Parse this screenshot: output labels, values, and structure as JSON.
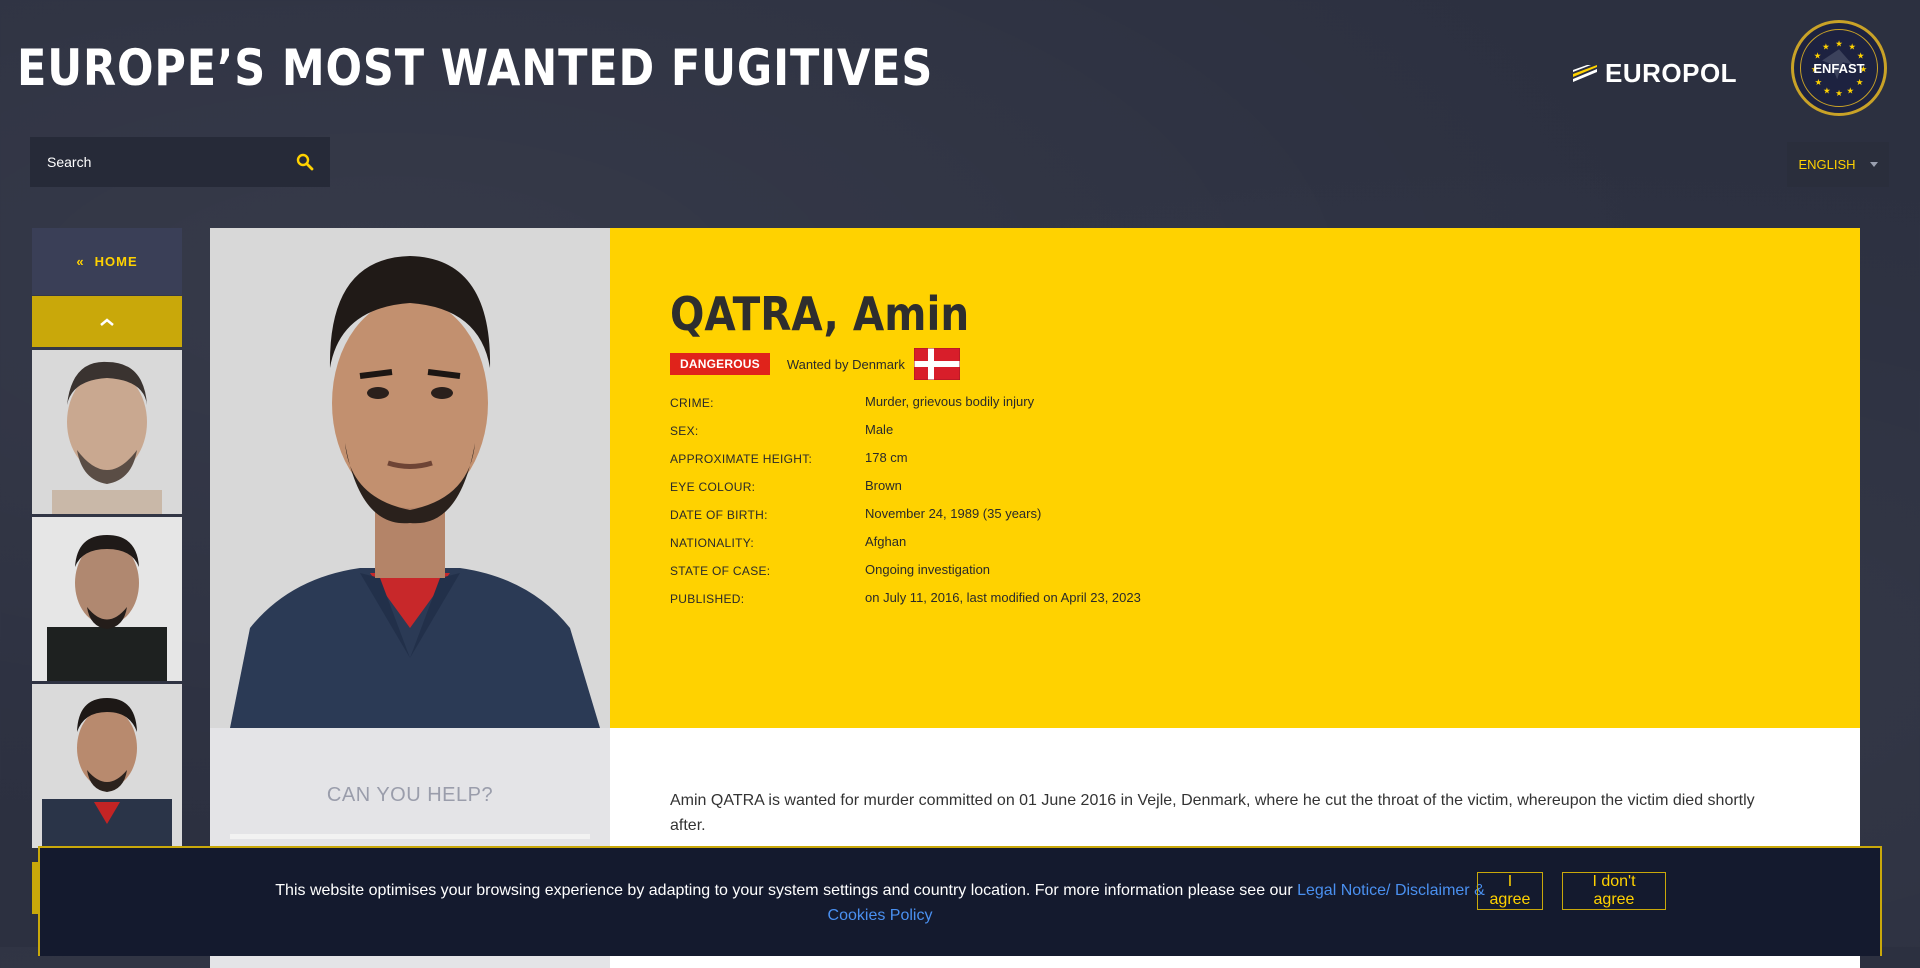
{
  "header": {
    "title": "EUROPE’S MOST WANTED FUGITIVES",
    "europol_label": "EUROPOL",
    "enfast_label": "ENFAST"
  },
  "search": {
    "placeholder": "Search"
  },
  "language": {
    "selected": "ENGLISH"
  },
  "sidebar": {
    "home_label": "HOME"
  },
  "profile": {
    "name": "QATRA, Amin",
    "badge": "DANGEROUS",
    "wanted_by": "Wanted by Denmark",
    "details": [
      {
        "label": "CRIME:",
        "value": "Murder, grievous bodily injury"
      },
      {
        "label": "SEX:",
        "value": "Male"
      },
      {
        "label": "APPROXIMATE HEIGHT:",
        "value": "178 cm"
      },
      {
        "label": "EYE COLOUR:",
        "value": "Brown"
      },
      {
        "label": "DATE OF BIRTH:",
        "value": "November 24, 1989 (35 years)"
      },
      {
        "label": "NATIONALITY:",
        "value": "Afghan"
      },
      {
        "label": "STATE OF CASE:",
        "value": "Ongoing investigation"
      },
      {
        "label": "PUBLISHED:",
        "value": "on July 11, 2016, last modified on April 23, 2023"
      }
    ],
    "help_title": "CAN YOU HELP?",
    "description": "Amin QATRA is wanted for murder committed on 01 June 2016 in Vejle, Denmark, where he cut the throat of the victim, whereupon the victim died shortly after."
  },
  "cookie": {
    "text": "This website optimises your browsing experience by adapting to your system settings and country location. For more information please see our",
    "link_label": "Legal Notice/ Disclaimer & Cookies Policy",
    "agree_label": "I agree",
    "disagree_label": "I don't agree"
  },
  "colors": {
    "accent_yellow": "#ffd200",
    "danger_red": "#e0231b",
    "background": "#2c3040",
    "link_blue": "#4a90f0"
  },
  "icons": [
    "search-icon",
    "double-chevron-left-icon",
    "chevron-up-icon",
    "caret-down-icon",
    "denmark-flag-icon"
  ]
}
